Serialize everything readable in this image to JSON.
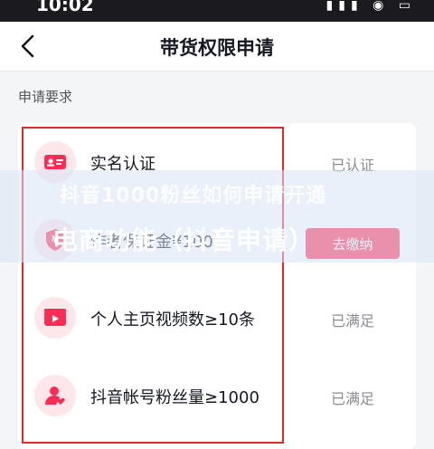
{
  "status_bar": {
    "time": "10:02",
    "icons": "▮▮▮ ◉ ▭"
  },
  "nav": {
    "title": "带货权限申请"
  },
  "section": {
    "title": "申请要求"
  },
  "requirements": [
    {
      "label": "实名认证",
      "status": "已认证",
      "icon": "id-card-icon"
    },
    {
      "label": "作者保证金¥100",
      "status": "去缴纳",
      "icon": "deposit-shield-icon"
    },
    {
      "label": "个人主页视频数≥10条",
      "status": "已满足",
      "icon": "video-icon"
    },
    {
      "label": "抖音帐号粉丝量≥1000",
      "status": "已满足",
      "icon": "fans-icon"
    }
  ],
  "overlay": {
    "line1": "抖音1000粉丝如何申请开通",
    "line2": "电商功能（抖音申请）"
  },
  "colors": {
    "accent": "#fe2c55",
    "icon_bg": "#fde7ea",
    "highlight": "#e0292f"
  }
}
